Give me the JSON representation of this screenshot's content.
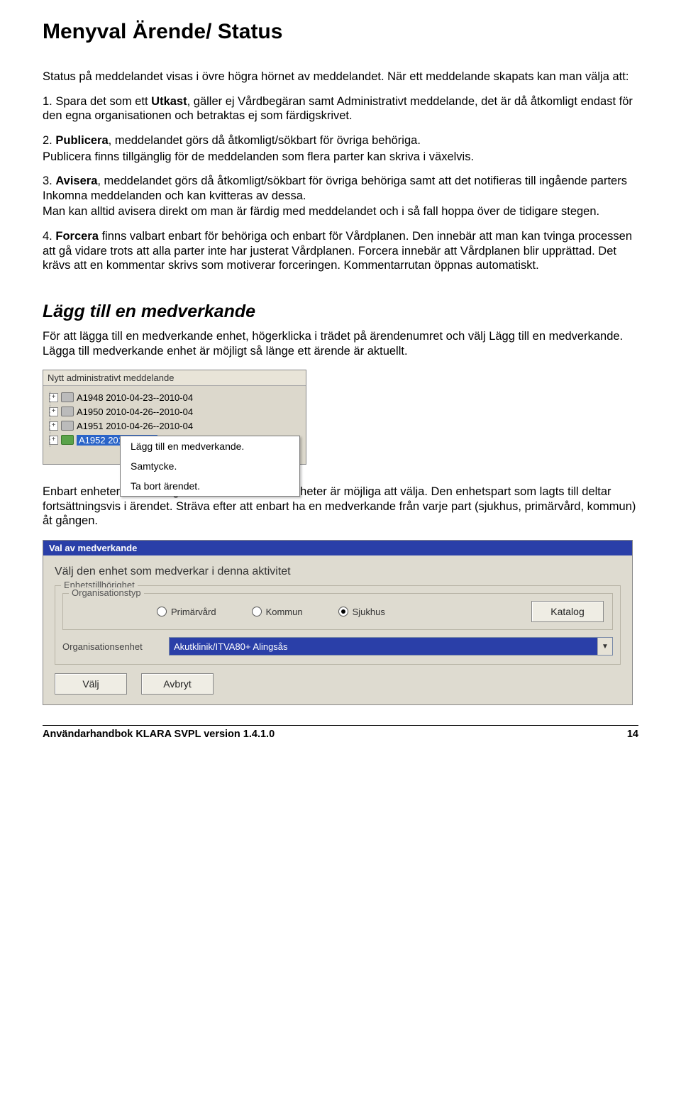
{
  "heading": "Menyval Ärende/ Status",
  "intro": "Status på meddelandet visas i övre högra hörnet av meddelandet. När ett meddelande skapats kan man välja att:",
  "items": {
    "p1a": "1. Spara det som ett ",
    "p1b": "Utkast",
    "p1c": ", gäller ej Vårdbegäran samt Administrativt meddelande, det är då åtkomligt endast för den egna organisationen och betraktas ej som färdigskrivet.",
    "p2a": "2. ",
    "p2b": "Publicera",
    "p2c": ", meddelandet görs då åtkomligt/sökbart för övriga behöriga.",
    "p2d": "Publicera finns tillgänglig för de meddelanden som flera parter kan skriva i växelvis.",
    "p3a": "3. ",
    "p3b": "Avisera",
    "p3c": ", meddelandet görs då åtkomligt/sökbart för övriga behöriga samt att det notifieras till ingående parters Inkomna meddelanden och kan kvitteras av dessa.",
    "p3d": "Man kan alltid avisera direkt om man är färdig med meddelandet och i så fall hoppa över de tidigare stegen.",
    "p4a": "4. ",
    "p4b": "Forcera",
    "p4c": " finns valbart enbart för behöriga och enbart för Vårdplanen. Den innebär att man kan tvinga processen att gå vidare trots att alla parter inte har justerat Vårdplanen. Forcera innebär att Vårdplanen blir upprättad. Det krävs att en kommentar skrivs som motiverar forceringen. Kommentarrutan öppnas automatiskt."
  },
  "section2_title": "Lägg till en medverkande",
  "section2_p1": "För att lägga till en medverkande enhet, högerklicka i trädet på ärendenumret och välj Lägg till en medverkande. Lägga till medverkande enhet är möjligt så länge ett ärende är aktuellt.",
  "shot1": {
    "header": "Nytt administrativt meddelande",
    "rows": [
      "A1948 2010-04-23--2010-04",
      "A1950 2010-04-26--2010-04",
      "A1951 2010-04-26--2010-04"
    ],
    "selected": "A1952 2010-04-26",
    "menu": [
      "Lägg till en medverkande.",
      "Samtycke.",
      "Ta bort ärendet."
    ]
  },
  "section2_p2": "Enbart enheter som är registrerade som SVPL-enheter är möjliga att välja. Den enhetspart som lagts till deltar fortsättningsvis i ärendet. Sträva efter att enbart ha en medverkande från varje part (sjukhus, primärvård, kommun) åt gången.",
  "shot2": {
    "title": "Val av medverkande",
    "prompt": "Välj den enhet som medverkar i denna aktivitet",
    "fs_label": "Enhetstillhörighet",
    "fs_inner_label": "Organisationstyp",
    "radios": {
      "r1": "Primärvård",
      "r2": "Kommun",
      "r3": "Sjukhus"
    },
    "katalog": "Katalog",
    "org_label": "Organisationsenhet",
    "org_value": "Akutklinik/ITVA80+ Alingsås",
    "btn_valj": "Välj",
    "btn_avbryt": "Avbryt"
  },
  "footer": {
    "left": "Användarhandbok KLARA SVPL version 1.4.1.0",
    "right": "14"
  }
}
